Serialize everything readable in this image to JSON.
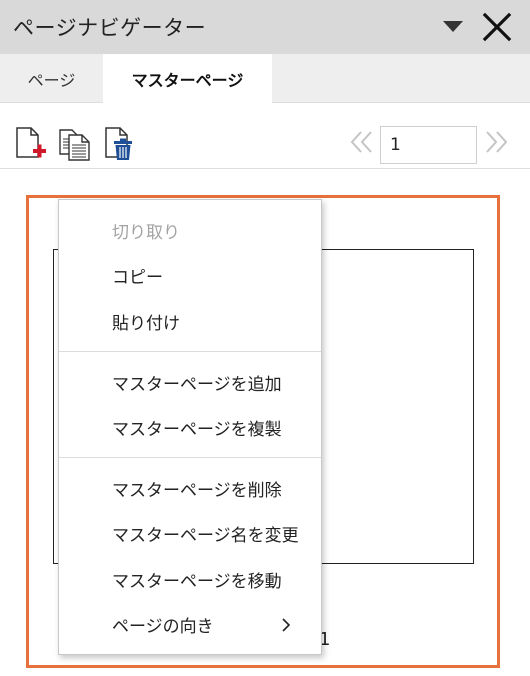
{
  "panel": {
    "title": "ページナビゲーター"
  },
  "tabs": [
    {
      "label": "ページ"
    },
    {
      "label": "マスターページ"
    }
  ],
  "toolbar": {
    "icons": [
      "add-page-icon",
      "copy-page-icon",
      "delete-page-icon"
    ],
    "page_number": "1"
  },
  "thumbnail": {
    "label": "1"
  },
  "context_menu": {
    "items": [
      {
        "label": "切り取り",
        "disabled": true
      },
      {
        "label": "コピー"
      },
      {
        "label": "貼り付け"
      },
      {
        "label": "マスターページを追加"
      },
      {
        "label": "マスターページを複製"
      },
      {
        "label": "マスターページを削除"
      },
      {
        "label": "マスターページ名を変更"
      },
      {
        "label": "マスターページを移動"
      },
      {
        "label": "ページの向き",
        "has_submenu": true
      }
    ]
  },
  "colors": {
    "accent_frame": "#e8703a",
    "delete_red": "#d0182a",
    "trash_blue": "#1f4f96"
  }
}
